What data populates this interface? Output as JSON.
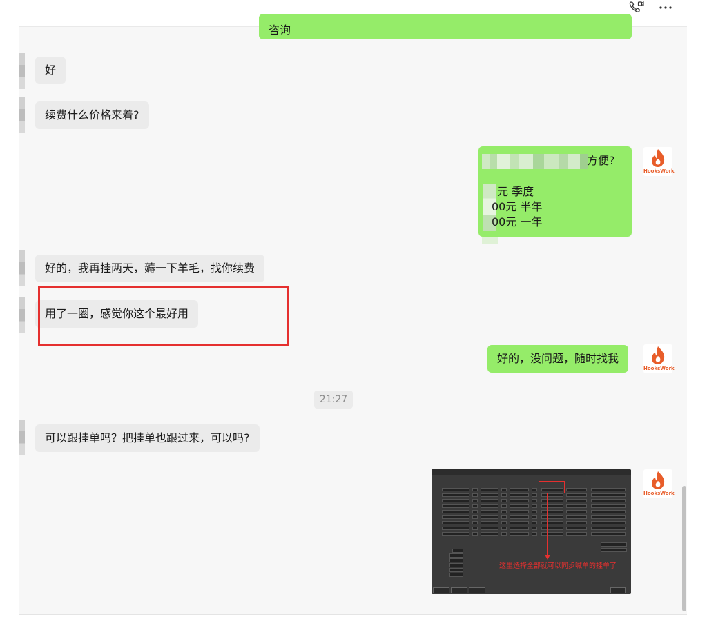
{
  "header": {
    "icons": [
      "video-call-icon",
      "more-icon"
    ]
  },
  "messages": {
    "top_partial": "咨询",
    "m1": "好",
    "m2": "续费什么价格来着?",
    "m3": {
      "line1_suffix": "方便?",
      "prices": [
        "元 季度",
        "00元 半年",
        "00元 一年"
      ]
    },
    "m4": "好的，我再挂两天，薅一下羊毛，找你续费",
    "m5": "用了一圈，感觉你这个最好用",
    "m6": "好的，没问题，随时找我",
    "timestamp": "21:27",
    "m7": "可以跟挂单吗？把挂单也跟过来，可以吗?",
    "image_note": "这里选择全部就可以同步喊单的挂单了"
  },
  "avatar": {
    "brand": "HooksWork"
  },
  "colors": {
    "outgoing_bubble": "#95ec69",
    "incoming_bubble": "#ebebeb",
    "highlight": "#e5302f",
    "brand_orange": "#e85d2a"
  }
}
